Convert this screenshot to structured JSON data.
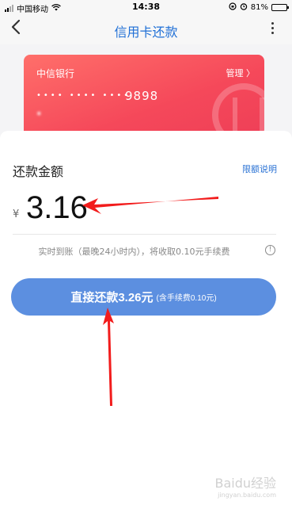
{
  "status_bar": {
    "carrier": "中国移动",
    "time": "14:38",
    "battery_percent": "81%",
    "battery_level": 0.81
  },
  "nav": {
    "back_icon": "chevron-left-icon",
    "title": "信用卡还款",
    "more_icon": "more-vertical-icon"
  },
  "card": {
    "bank_name": "中信银行",
    "manage_label": "管理 〉",
    "masked_digits": "•••• •••• ••••",
    "last_four": "9898",
    "holder_name": "*"
  },
  "repayment": {
    "section_title": "还款金额",
    "limit_link": "限额说明",
    "currency_symbol": "¥",
    "amount": "3.16",
    "fee_note": "实时到账（最晚24小时内），将收取0.10元手续费",
    "info_icon": "info-icon"
  },
  "pay_button": {
    "main_label": "直接还款3.26元",
    "sub_label": "(含手续费0.10元)"
  },
  "watermark": {
    "brand": "Baidu经验",
    "url": "jingyan.baidu.com"
  },
  "colors": {
    "accent": "#1f6fd6",
    "button": "#5c8fe0",
    "card_start": "#ff6f6a",
    "card_end": "#ee3f57",
    "annotation_arrow": "#f21c1c"
  }
}
